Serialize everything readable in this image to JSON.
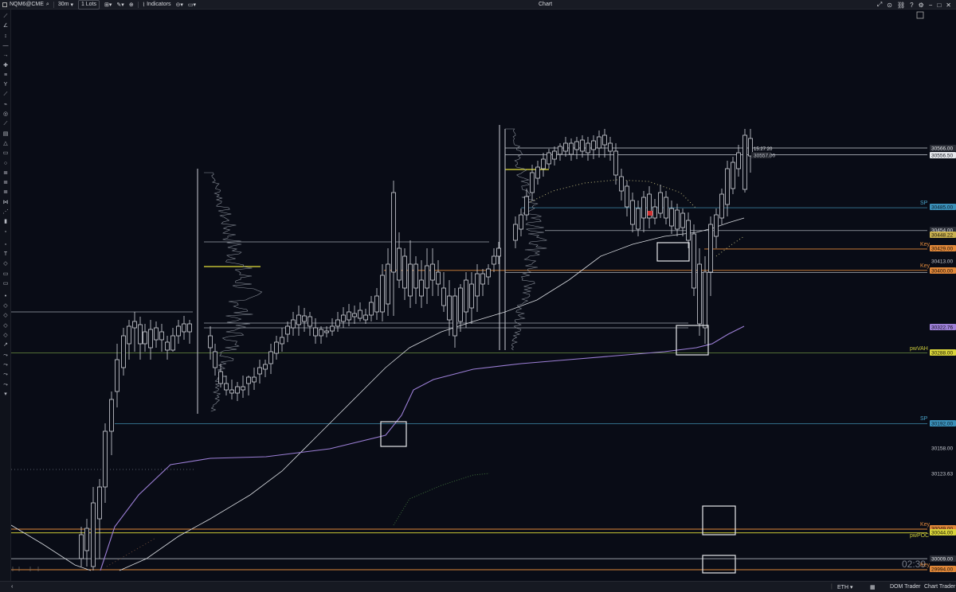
{
  "toolbar": {
    "symbol": "NQM6@CME",
    "timeframe": "30m",
    "lots": "1 Lots",
    "indicators": "Indicators",
    "title": "Chart"
  },
  "chart": {
    "time_label": "15:27:20",
    "countdown": "02:39",
    "price_labels": [
      {
        "text": "30566.00",
        "kind": "plain"
      },
      {
        "text": "30556.50",
        "kind": "white"
      },
      {
        "text": "30557.00",
        "kind": "dark"
      },
      {
        "text": "30485.00",
        "kind": "blue"
      },
      {
        "text": "30454.00",
        "kind": "plain"
      },
      {
        "text": "30448.22",
        "kind": "gold"
      },
      {
        "text": "30429.00",
        "kind": "orange"
      },
      {
        "text": "30413.00",
        "kind": "dark"
      },
      {
        "text": "30400.00",
        "kind": "orange"
      },
      {
        "text": "30322.76",
        "kind": "purple"
      },
      {
        "text": "30288.00",
        "kind": "yellow"
      },
      {
        "text": "30192.00",
        "kind": "blue"
      },
      {
        "text": "30158.00",
        "kind": "dark"
      },
      {
        "text": "30123.63",
        "kind": "dark"
      },
      {
        "text": "30049.00",
        "kind": "orange"
      },
      {
        "text": "30044.00",
        "kind": "yellow"
      },
      {
        "text": "30009.00",
        "kind": "plain"
      },
      {
        "text": "29994.00",
        "kind": "orange"
      }
    ],
    "level_labels": [
      {
        "text": "SP",
        "color": "#4aa3c8"
      },
      {
        "text": "Key",
        "color": "#e0883a"
      },
      {
        "text": "Key",
        "color": "#e0883a"
      },
      {
        "text": "pwVAH",
        "color": "#c8c83a"
      },
      {
        "text": "SP",
        "color": "#4aa3c8"
      },
      {
        "text": "Key",
        "color": "#e0883a"
      },
      {
        "text": "pwPOC",
        "color": "#c8c83a"
      },
      {
        "text": "Key",
        "color": "#e0883a"
      }
    ]
  },
  "statusbar": {
    "session": "ETH",
    "dom_trader": "DOM Trader",
    "chart_trader": "Chart Trader"
  },
  "colors": {
    "background": "#090c16",
    "up_candle": "#0b0e17",
    "candle_outline": "#d0d3da",
    "vwap_purple": "#9c7fd6",
    "ma_white": "#d8dbe0",
    "key_orange": "#e0883a",
    "sp_blue": "#4aa3c8",
    "poc_yellow": "#e3e03a"
  }
}
